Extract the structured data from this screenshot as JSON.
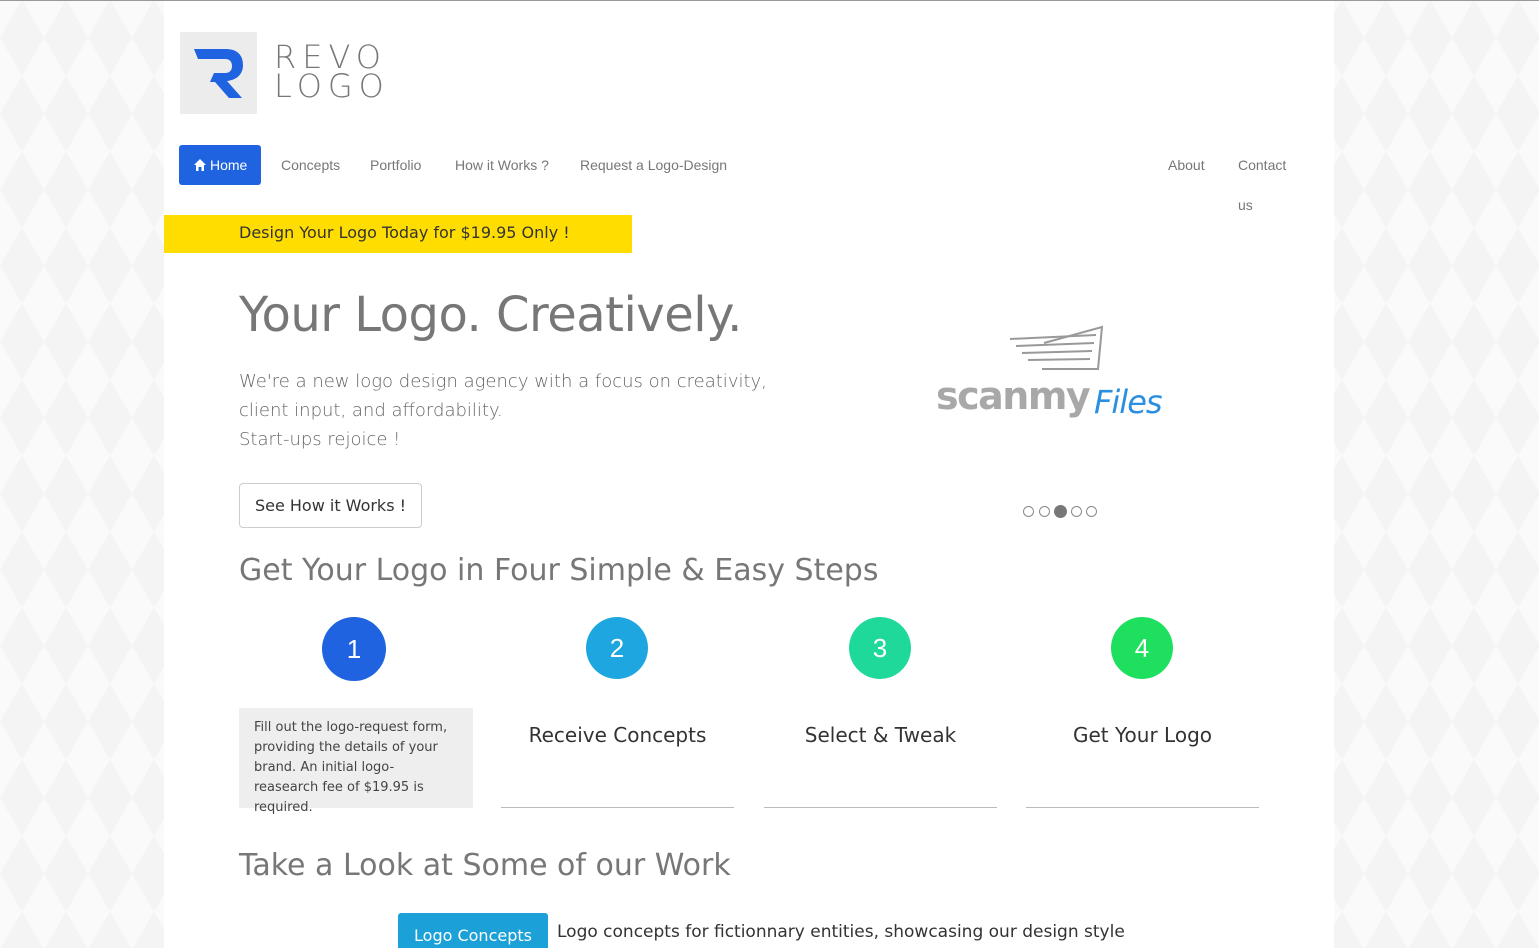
{
  "brand": {
    "line1": "REVO",
    "line2": "LOGO"
  },
  "nav": {
    "home": "Home",
    "concepts": "Concepts",
    "portfolio": "Portfolio",
    "how": "How it Works ?",
    "request": "Request a Logo-Design",
    "about": "About",
    "contact": "Contact us"
  },
  "promo_banner": "Design Your Logo Today for $19.95 Only !",
  "hero": {
    "title": "Your Logo. Creatively.",
    "line1": "We're a new logo design agency with a focus on creativity,",
    "line2": "client input, and affordability.",
    "line3": "Start-ups rejoice !",
    "button": "See How it Works !"
  },
  "carousel": {
    "slide_text_a": "scanmy",
    "slide_text_b": "Files",
    "slide_count": 5,
    "active_index": 2
  },
  "steps": {
    "title": "Get Your Logo in Four Simple & Easy Steps",
    "items": [
      {
        "number": "1",
        "color": "#1f63e0",
        "desc": "Fill out the logo-request form, providing the details of your brand. An initial logo-reasearch fee of $19.95 is required."
      },
      {
        "number": "2",
        "color": "#1da6e0",
        "label": "Receive Concepts"
      },
      {
        "number": "3",
        "color": "#1fd99a",
        "label": "Select & Tweak"
      },
      {
        "number": "4",
        "color": "#1fe05e",
        "label": "Get Your Logo"
      }
    ]
  },
  "work": {
    "title": "Take a Look at Some of our Work",
    "button": "Logo Concepts",
    "desc": "Logo concepts for fictionnary entities, showcasing our design style"
  },
  "colors": {
    "accent": "#1f63e0",
    "banner": "#ffdd00",
    "concepts_button": "#1ba1d8"
  },
  "icons": {
    "home": "home-icon"
  }
}
